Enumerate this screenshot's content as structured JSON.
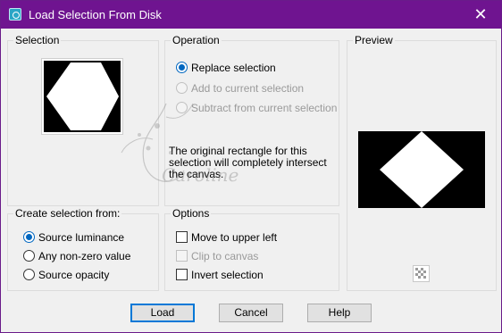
{
  "window": {
    "title": "Load Selection From Disk",
    "close_glyph": "✕",
    "titlebar_color": "#6f1490",
    "accent": "#0067c0"
  },
  "selection": {
    "label": "Selection"
  },
  "operation": {
    "label": "Operation",
    "options": [
      {
        "label": "Replace selection",
        "checked": true,
        "enabled": true
      },
      {
        "label": "Add to current selection",
        "checked": false,
        "enabled": false
      },
      {
        "label": "Subtract from current selection",
        "checked": false,
        "enabled": false
      }
    ],
    "info": "The original rectangle for this selection will completely intersect the canvas."
  },
  "preview": {
    "label": "Preview",
    "icon": "checkerboard-icon"
  },
  "create_from": {
    "label": "Create selection from:",
    "options": [
      {
        "label": "Source luminance",
        "checked": true
      },
      {
        "label": "Any non-zero value",
        "checked": false
      },
      {
        "label": "Source opacity",
        "checked": false
      }
    ]
  },
  "options": {
    "label": "Options",
    "items": [
      {
        "label": "Move to upper left",
        "checked": false,
        "enabled": true
      },
      {
        "label": "Clip to canvas",
        "checked": false,
        "enabled": false
      },
      {
        "label": "Invert selection",
        "checked": false,
        "enabled": true
      }
    ]
  },
  "buttons": {
    "load": "Load",
    "cancel": "Cancel",
    "help": "Help"
  },
  "watermark": {
    "text": "Caroline"
  }
}
